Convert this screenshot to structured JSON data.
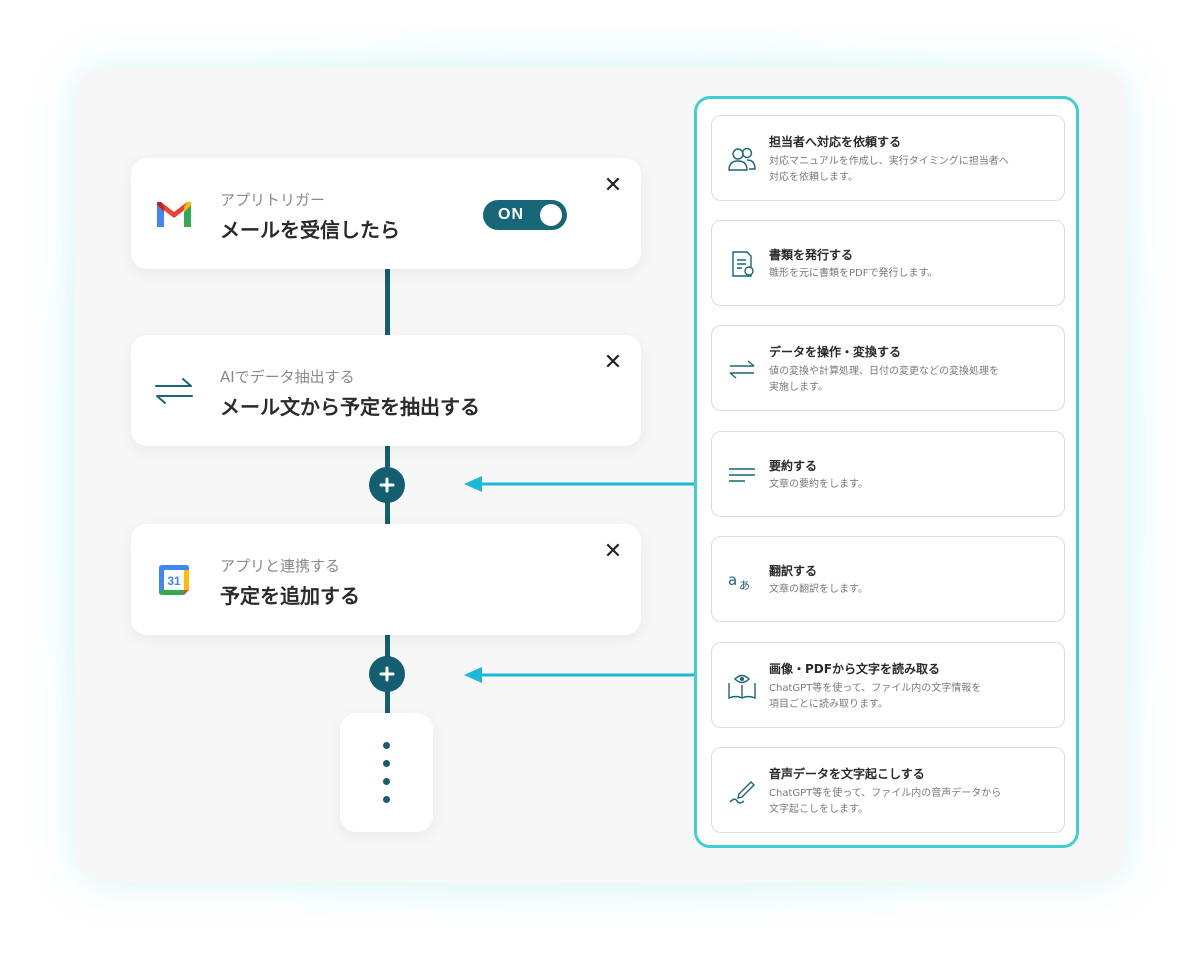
{
  "colors": {
    "primary": "#135e71",
    "accent": "#3fcfcf",
    "arrow": "#1bb8d8"
  },
  "trigger": {
    "subtitle": "アプリトリガー",
    "title": "メールを受信したら",
    "toggle_label": "ON",
    "icon": "gmail-icon"
  },
  "step2": {
    "subtitle": "AIでデータ抽出する",
    "title": "メール文から予定を抽出する",
    "icon": "swap-arrows-icon"
  },
  "step3": {
    "subtitle": "アプリと連携する",
    "title": "予定を追加する",
    "icon": "google-calendar-icon",
    "calendar_day": "31"
  },
  "actions": [
    {
      "title": "担当者へ対応を依頼する",
      "desc": "対応マニュアルを作成し、実行タイミングに担当者へ\n対応を依頼します。",
      "icon": "people-icon"
    },
    {
      "title": "書類を発行する",
      "desc": "雛形を元に書類をPDFで発行します。",
      "icon": "document-icon"
    },
    {
      "title": "データを操作・変換する",
      "desc": "値の変換や計算処理、日付の変更などの変換処理を\n実施します。",
      "icon": "swap-arrows-icon"
    },
    {
      "title": "要約する",
      "desc": "文章の要約をします。",
      "icon": "lines-icon"
    },
    {
      "title": "翻訳する",
      "desc": "文章の翻訳をします。",
      "icon": "translate-icon"
    },
    {
      "title": "画像・PDFから文字を読み取る",
      "desc": "ChatGPT等を使って、ファイル内の文字情報を\n項目ごとに読み取ります。",
      "icon": "book-eye-icon"
    },
    {
      "title": "音声データを文字起こしする",
      "desc": "ChatGPT等を使って、ファイル内の音声データから\n文字起こしをします。",
      "icon": "pen-icon"
    }
  ]
}
